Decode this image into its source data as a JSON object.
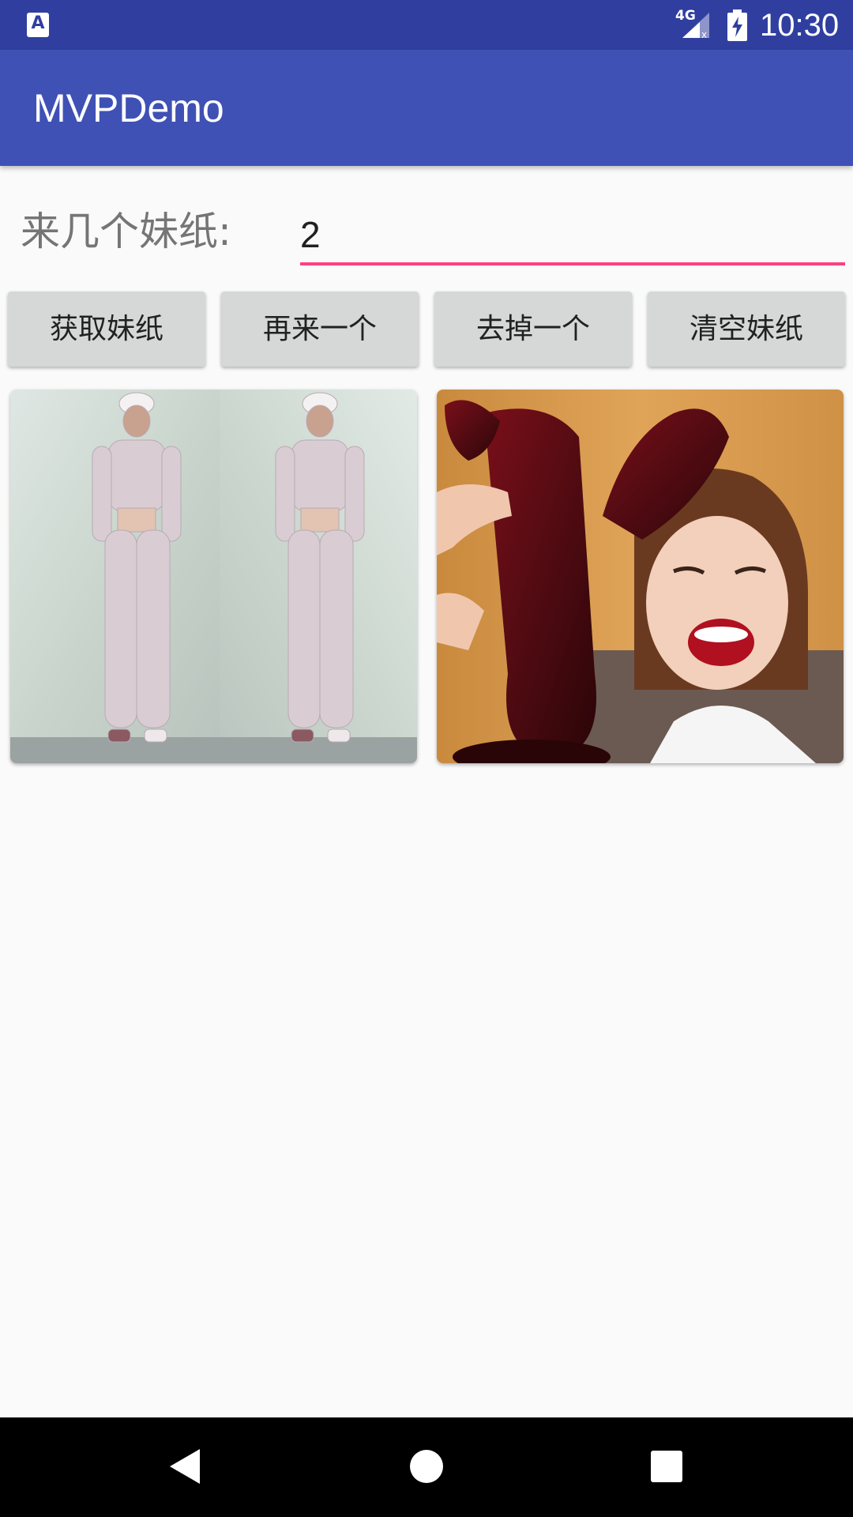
{
  "status_bar": {
    "app_icon_letter": "A",
    "network_label": "4G",
    "time": "10:30",
    "icons": [
      "app-notification-icon",
      "signal-icon",
      "battery-charging-icon"
    ]
  },
  "app_bar": {
    "title": "MVPDemo",
    "color": "#3f51b5"
  },
  "form": {
    "count_label": "来几个妹纸:",
    "count_value": "2",
    "underline_color": "#ff4081"
  },
  "buttons": {
    "get": "获取妹纸",
    "add_one": "再来一个",
    "remove_one": "去掉一个",
    "clear": "清空妹纸"
  },
  "gallery": {
    "items": [
      {
        "kind": "photo",
        "subject": "mirrored fashion photo of woman in white outfit"
      },
      {
        "kind": "photo",
        "subject": "laughing woman holding dark red lobster figure"
      }
    ]
  },
  "nav_bar": {
    "icons": [
      "back-icon",
      "home-icon",
      "recents-icon"
    ]
  }
}
